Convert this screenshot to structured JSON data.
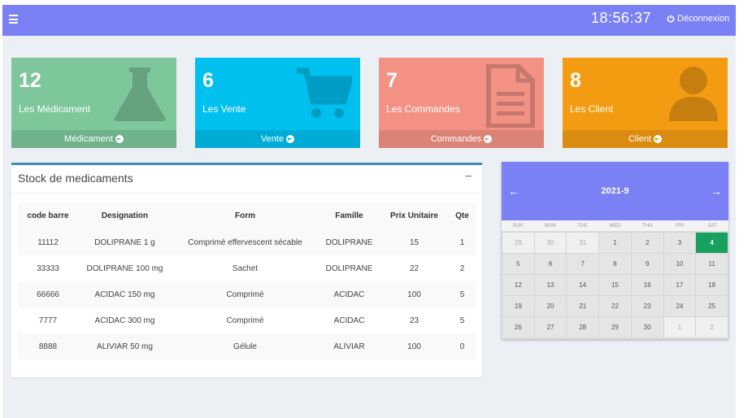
{
  "header": {
    "time": "18:56:37",
    "logout_label": "Déconnexion"
  },
  "stats": [
    {
      "count": "12",
      "label": "Les Médicament",
      "link": "Médicament",
      "color": "#7dc79a",
      "icon": "flask-icon"
    },
    {
      "count": "6",
      "label": "Les Vente",
      "link": "Vente",
      "color": "#00c0ef",
      "icon": "cart-icon"
    },
    {
      "count": "7",
      "label": "Les Commandes",
      "link": "Commandes",
      "color": "#f39284",
      "icon": "document-icon"
    },
    {
      "count": "8",
      "label": "Les Client",
      "link": "Client",
      "color": "#f39c12",
      "icon": "user-icon"
    }
  ],
  "stock": {
    "title": "Stock de medicaments",
    "columns": [
      "code barre",
      "Designation",
      "Form",
      "Famille",
      "Prix Unitaire",
      "Qte"
    ],
    "rows": [
      [
        "11112",
        "DOLIPRANE 1 g",
        "Comprimé effervescent sécable",
        "DOLIPRANE",
        "15",
        "1"
      ],
      [
        "33333",
        "DOLIPRANE 100 mg",
        "Sachet",
        "DOLIPRANE",
        "22",
        "2"
      ],
      [
        "66666",
        "ACIDAC 150 mg",
        "Comprimé",
        "ACIDAC",
        "100",
        "5"
      ],
      [
        "7777",
        "ACIDAC 300 mg",
        "Comprimé",
        "ACIDAC",
        "23",
        "5"
      ],
      [
        "8888",
        "ALIVIAR 50 mg",
        "Gélule",
        "ALIVIAR",
        "100",
        "0"
      ]
    ]
  },
  "calendar": {
    "title": "2021-9",
    "prev": "←",
    "next": "→",
    "days": [
      "SUN",
      "MON",
      "TUE",
      "WED",
      "THU",
      "FRI",
      "SAT"
    ],
    "weeks": [
      [
        "29",
        "30",
        "31",
        "1",
        "2",
        "3",
        "4"
      ],
      [
        "5",
        "6",
        "7",
        "8",
        "9",
        "10",
        "11"
      ],
      [
        "12",
        "13",
        "14",
        "15",
        "16",
        "17",
        "18"
      ],
      [
        "19",
        "20",
        "21",
        "22",
        "23",
        "24",
        "25"
      ],
      [
        "26",
        "27",
        "28",
        "29",
        "30",
        "1",
        "2"
      ]
    ],
    "muted": [
      [
        0,
        0
      ],
      [
        0,
        1
      ],
      [
        0,
        2
      ],
      [
        4,
        5
      ],
      [
        4,
        6
      ]
    ],
    "today": [
      0,
      6
    ]
  }
}
